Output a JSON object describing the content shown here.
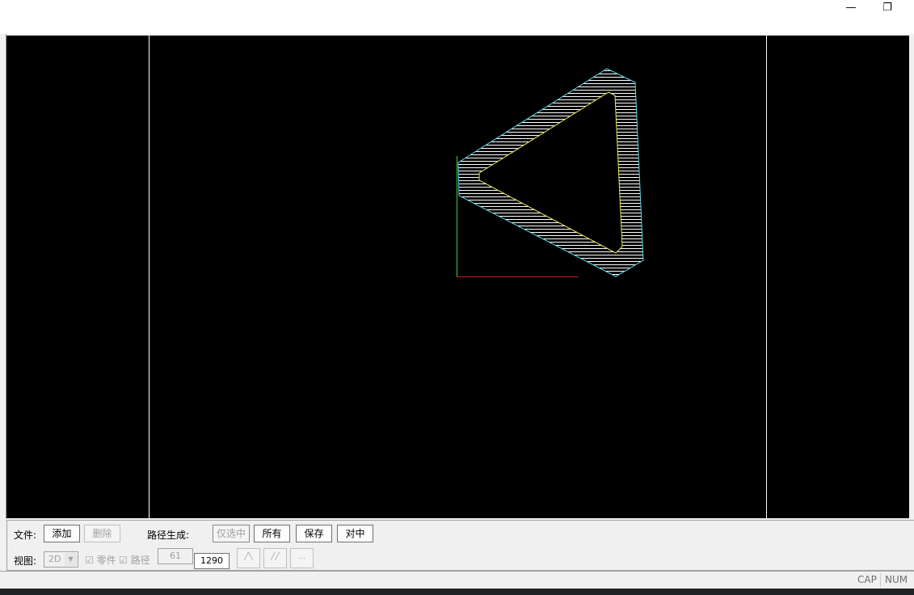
{
  "window": {
    "minimize_icon": "minimize-icon",
    "restore_icon": "restore-icon"
  },
  "panel": {
    "file_label": "文件:",
    "add": "添加",
    "delete": "删除",
    "path_gen_label": "路径生成:",
    "selected_only": "仅选中",
    "all": "所有",
    "save": "保存",
    "center": "对中",
    "view_label": "视图:",
    "view_mode": "2D",
    "parts_label": "零件",
    "path_label": "路径",
    "value1": "61",
    "value2": "1290"
  },
  "status": {
    "cap": "CAP",
    "num": "NUM"
  },
  "colors": {
    "outer": "#5fd7e6",
    "inner": "#e8e85a",
    "hatch": "#ffffff",
    "axis_y": "#3ccf3c",
    "axis_x": "#d02020"
  }
}
